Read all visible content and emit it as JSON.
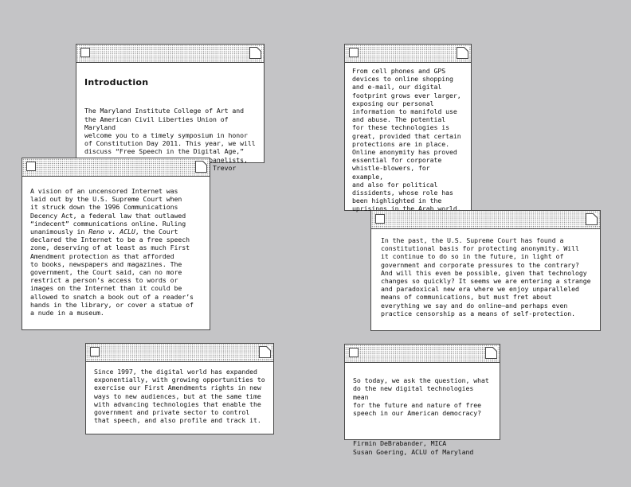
{
  "windows": {
    "intro": {
      "heading": "Introduction",
      "body": "The Maryland Institute College of Art and\nthe American Civil Liberties Union of Maryland\nwelcome you to a timely symposium in honor\nof Constitution Day 2011. This year, we will\ndiscuss “Free Speech in the Digital Age,”\nand are honored by our esteemed panelists,\nAndrew Sullivan, Jay Stanley and Trevor Paglen."
    },
    "internet": {
      "before": "A vision of an uncensored Internet was\nlaid out by the U.S. Supreme Court when\nit struck down the 1996 Communications\nDecency Act, a federal law that outlawed\n“indecent” communications online. Ruling\nunanimously in ",
      "case": "Reno v. ACLU",
      "after": ", the Court\ndeclared the Internet to be a free speech\nzone, deserving of at least as much First\nAmendment protection as that afforded\nto books, newspapers and magazines. The\ngovernment, the Court said, can no more\nrestrict a person’s access to words or\nimages on the Internet than it could be\nallowed to snatch a book out of a reader’s\nhands in the library, or cover a statue of\na nude in a museum."
    },
    "since1997": {
      "body": "Since 1997, the digital world has expanded\nexponentially, with growing opportunities to\nexercise our First Amendments rights in new\nways to new audiences, but at the same time\nwith advancing technologies that enable the\ngovernment and private sector to control\nthat speech, and also profile and track it."
    },
    "cellphones": {
      "body": "From cell phones and GPS\ndevices to online shopping\nand e-mail, our digital\nfootprint grows ever larger,\nexposing our personal\ninformation to manifold use\nand abuse. The potential\nfor these technologies is\ngreat, provided that certain\nprotections are in place.\nOnline anonymity has proved\nessential for corporate\nwhistle-blowers, for example,\nand also for political\ndissidents, whose role has\nbeen highlighted in the\nuprisings in the Arab world."
    },
    "anonymity": {
      "body": "In the past, the U.S. Supreme Court has found a\nconstitutional basis for protecting anonymity. Will\nit continue to do so in the future, in light of\ngovernment and corporate pressures to the contrary?\nAnd will this even be possible, given that technology\nchanges so quickly? It seems we are entering a strange\nand paradoxical new era where we enjoy unparalleled\nmeans of communications, but must fret about\neverything we say and do online—and perhaps even\npractice censorship as a means of self-protection."
    },
    "question": {
      "body": "So today, we ask the question, what\ndo the new digital technologies mean\nfor the future and nature of free\nspeech in our American democracy?",
      "signature": "Firmin DeBrabander, MICA\nSusan Goering, ACLU of Maryland"
    }
  }
}
